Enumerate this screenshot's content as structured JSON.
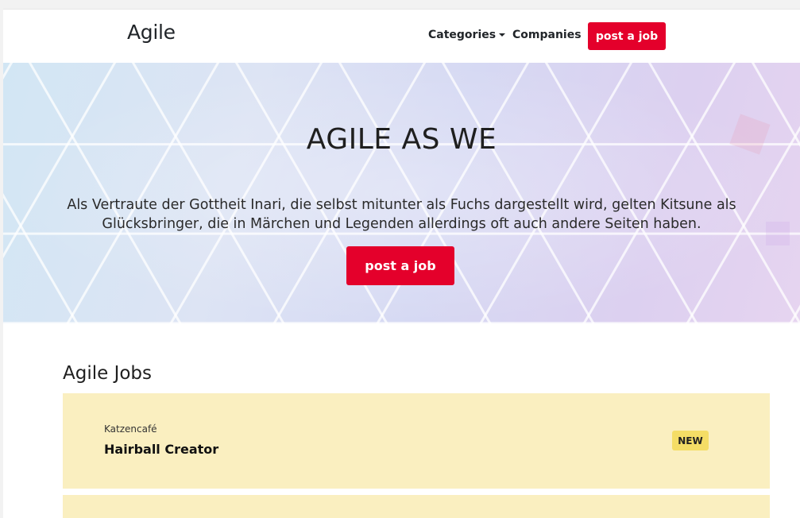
{
  "navbar": {
    "brand": "Agile",
    "categories_label": "Categories",
    "companies_label": "Companies",
    "post_job_label": "post a job"
  },
  "hero": {
    "title": "AGILE AS WE",
    "text": "Als Vertraute der Gottheit Inari, die selbst mitunter als Fuchs dargestellt wird, gelten Kitsune als Glücksbringer, die in Märchen und Legenden allerdings oft auch andere Seiten haben.",
    "post_job_label": "post a job"
  },
  "jobs": {
    "heading": "Agile Jobs",
    "items": [
      {
        "company": "Katzencafé",
        "title": "Hairball Creator",
        "badge": "NEW"
      }
    ]
  },
  "colors": {
    "accent": "#e4002b",
    "job_card_bg": "#faefc0",
    "badge_bg": "#f4dd66"
  }
}
